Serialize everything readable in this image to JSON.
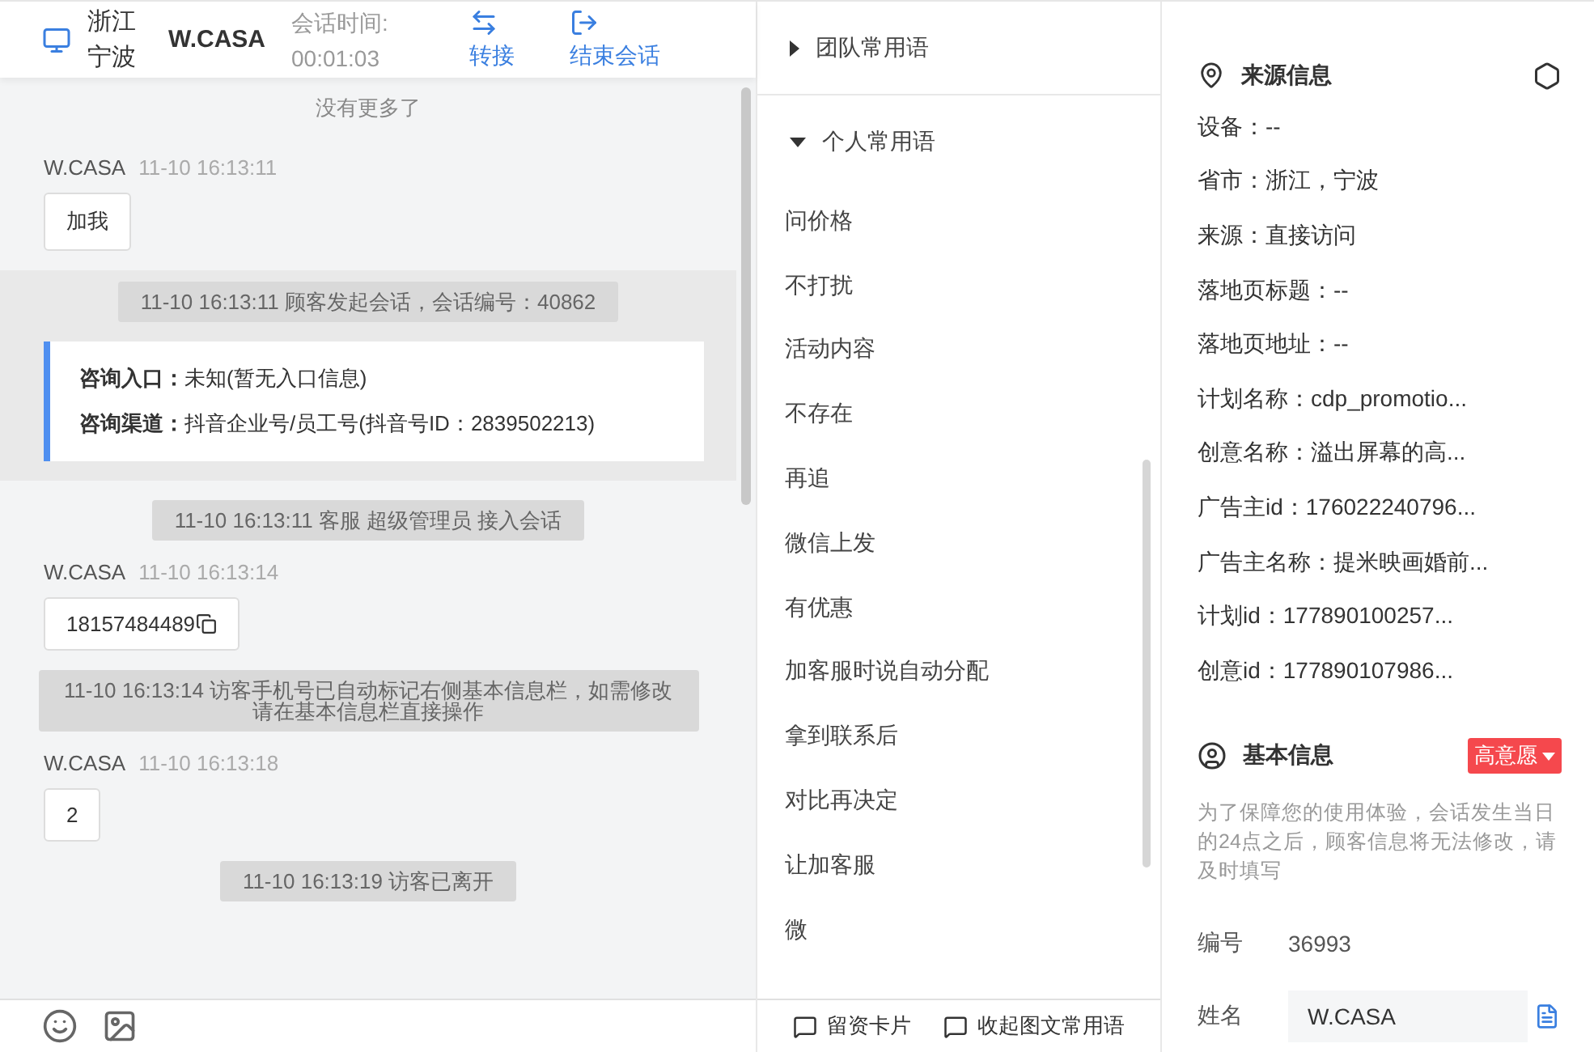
{
  "chat": {
    "header": {
      "location": "浙江宁波",
      "visitor": "W.CASA",
      "duration_label": "会话时间:",
      "duration": "00:01:03",
      "actions": [
        {
          "kind": "transfer",
          "label": "转接"
        },
        {
          "kind": "end",
          "label": "结束会话"
        }
      ]
    },
    "no_more": "没有更多了",
    "messages": [
      {
        "kind": "visitor",
        "name": "W.CASA",
        "time": "11-10 16:13:11",
        "text": "加我",
        "copyable": false
      },
      {
        "kind": "band",
        "items": [
          {
            "kind": "system",
            "text": "11-10 16:13:11 顾客发起会话，会话编号：40862"
          },
          {
            "kind": "info",
            "rows": [
              {
                "label": "咨询入口：",
                "value": "未知(暂无入口信息)"
              },
              {
                "label": "咨询渠道：",
                "value": "抖音企业号/员工号(抖音号ID：2839502213)"
              }
            ]
          }
        ]
      },
      {
        "kind": "system",
        "text": "11-10 16:13:11 客服 超级管理员 接入会话"
      },
      {
        "kind": "visitor",
        "name": "W.CASA",
        "time": "11-10 16:13:14",
        "text": "18157484489",
        "copyable": true
      },
      {
        "kind": "system",
        "text": "11-10 16:13:14 访客手机号已自动标记右侧基本信息栏，如需修改请在基本信息栏直接操作"
      },
      {
        "kind": "visitor",
        "name": "W.CASA",
        "time": "11-10 16:13:18",
        "text": "2",
        "copyable": false
      },
      {
        "kind": "system",
        "text": "11-10 16:13:19 访客已离开"
      }
    ]
  },
  "phrases": {
    "groups": [
      {
        "title": "团队常用语",
        "expanded": false
      },
      {
        "title": "个人常用语",
        "expanded": true,
        "items": [
          "问价格",
          "不打扰",
          "活动内容",
          "不存在",
          "再追",
          "微信上发",
          "有优惠",
          "加客服时说自动分配",
          "拿到联系后",
          "对比再决定",
          "让加客服",
          "微"
        ]
      }
    ],
    "footer": [
      {
        "label": "留资卡片"
      },
      {
        "label": "收起图文常用语"
      }
    ]
  },
  "source_info": {
    "title": "来源信息",
    "rows": [
      "设备：--",
      "省市：浙江，宁波",
      "来源：直接访问",
      "落地页标题：--",
      "落地页地址：--",
      "计划名称：cdp_promotio...",
      "创意名称：溢出屏幕的高...",
      "广告主id：176022240796...",
      "广告主名称：提米映画婚前...",
      "计划id：177890100257...",
      "创意id：177890107986..."
    ]
  },
  "basic_info": {
    "title": "基本信息",
    "intent": {
      "label": "高意愿",
      "color": "#f5484d"
    },
    "notice": "为了保障您的使用体验，会话发生当日的24点之后，顾客信息将无法修改，请及时填写",
    "fields": [
      {
        "kind": "text",
        "label": "编号",
        "value": "36993"
      },
      {
        "kind": "input",
        "label": "姓名",
        "value": "W.CASA"
      }
    ]
  }
}
